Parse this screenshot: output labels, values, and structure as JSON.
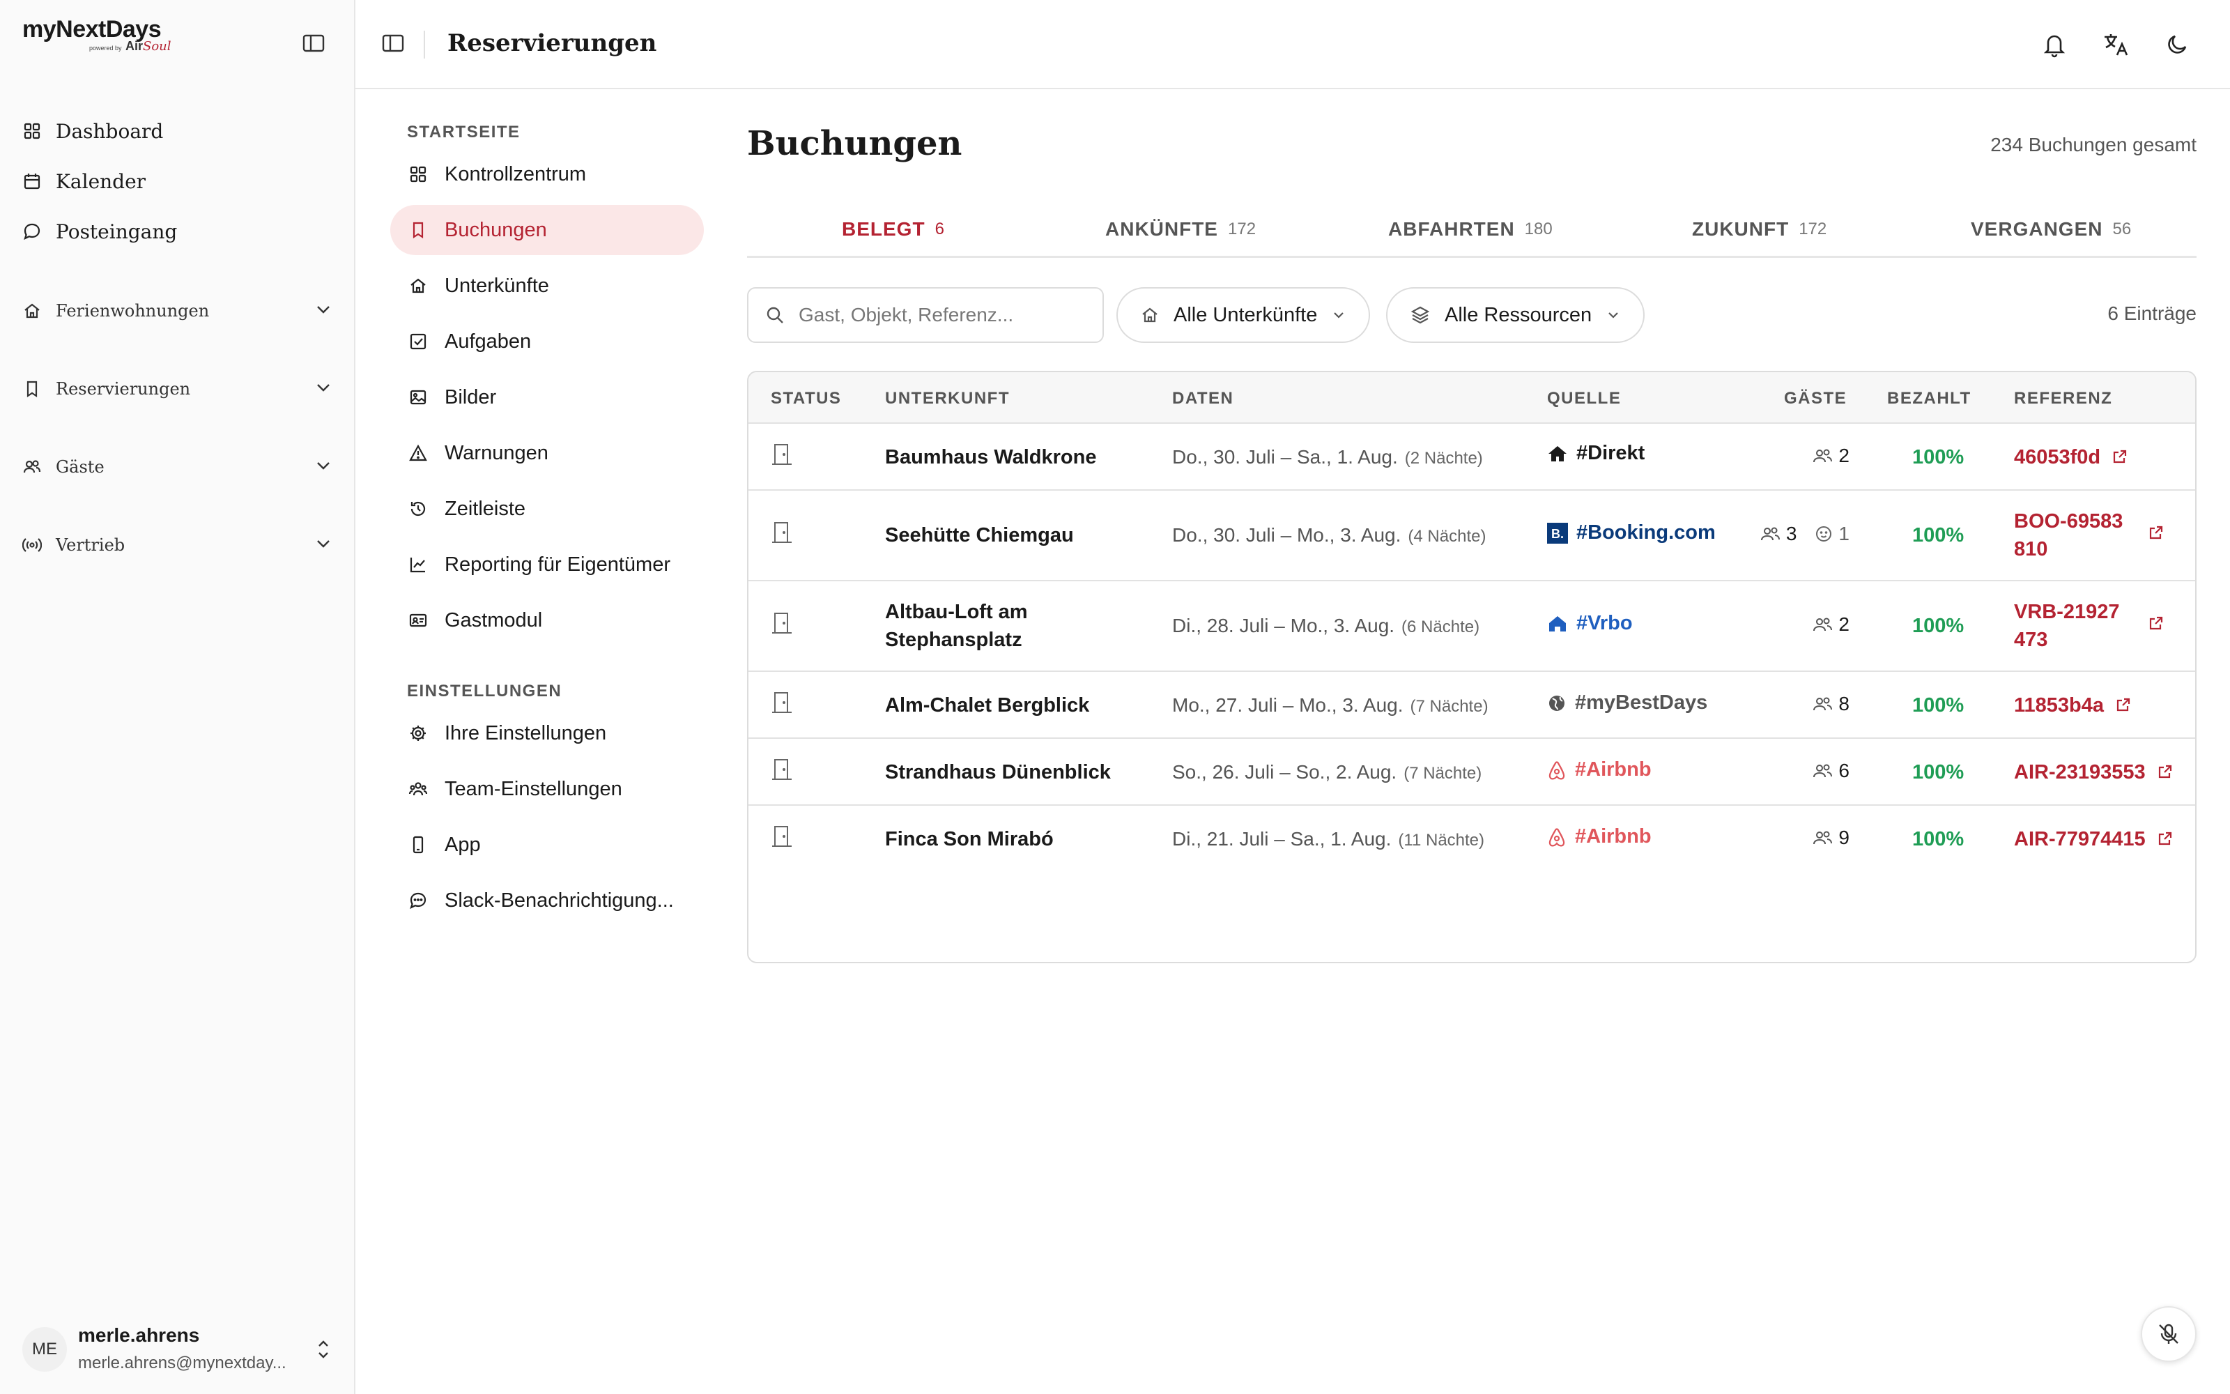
{
  "app": {
    "logo_text": "myNextDays",
    "powered_by": "powered by",
    "brand_prefix": "Air",
    "brand_suffix": "Soul"
  },
  "sidebar": {
    "main_items": [
      {
        "label": "Dashboard",
        "icon": "grid-icon"
      },
      {
        "label": "Kalender",
        "icon": "calendar-icon"
      },
      {
        "label": "Posteingang",
        "icon": "chat-bubble-icon"
      }
    ],
    "groups": [
      {
        "label": "Ferienwohnungen",
        "icon": "house-icon"
      },
      {
        "label": "Reservierungen",
        "icon": "bookmark-icon"
      },
      {
        "label": "Gäste",
        "icon": "users-icon"
      },
      {
        "label": "Vertrieb",
        "icon": "broadcast-icon"
      }
    ],
    "user": {
      "initials": "ME",
      "name": "merle.ahrens",
      "email": "merle.ahrens@mynextday..."
    }
  },
  "header": {
    "title": "Reservierungen"
  },
  "subnav": {
    "sections": [
      {
        "label": "STARTSEITE",
        "items": [
          {
            "label": "Kontrollzentrum",
            "icon": "grid-icon"
          },
          {
            "label": "Buchungen",
            "icon": "bookmark-icon",
            "active": true
          },
          {
            "label": "Unterkünfte",
            "icon": "house-icon"
          },
          {
            "label": "Aufgaben",
            "icon": "checkbox-icon"
          },
          {
            "label": "Bilder",
            "icon": "image-icon"
          },
          {
            "label": "Warnungen",
            "icon": "warning-icon"
          },
          {
            "label": "Zeitleiste",
            "icon": "history-icon"
          },
          {
            "label": "Reporting für Eigentümer",
            "icon": "chart-line-icon"
          },
          {
            "label": "Gastmodul",
            "icon": "id-card-icon"
          }
        ]
      },
      {
        "label": "EINSTELLUNGEN",
        "items": [
          {
            "label": "Ihre Einstellungen",
            "icon": "gear-icon"
          },
          {
            "label": "Team-Einstellungen",
            "icon": "team-icon"
          },
          {
            "label": "App",
            "icon": "phone-icon"
          },
          {
            "label": "Slack-Benachrichtigung...",
            "icon": "message-icon"
          }
        ]
      }
    ]
  },
  "main": {
    "title": "Buchungen",
    "total": "234 Buchungen gesamt",
    "tabs": [
      {
        "label": "BELEGT",
        "count": "6",
        "active": true
      },
      {
        "label": "ANKÜNFTE",
        "count": "172"
      },
      {
        "label": "ABFAHRTEN",
        "count": "180"
      },
      {
        "label": "ZUKUNFT",
        "count": "172"
      },
      {
        "label": "VERGANGEN",
        "count": "56"
      }
    ],
    "search": {
      "placeholder": "Gast, Objekt, Referenz..."
    },
    "filters": {
      "unterkuenfte": "Alle Unterkünfte",
      "ressourcen": "Alle Ressourcen"
    },
    "entries": "6 Einträge",
    "table": {
      "columns": [
        "STATUS",
        "UNTERKUNFT",
        "DATEN",
        "QUELLE",
        "GÄSTE",
        "BEZAHLT",
        "REFERENZ"
      ],
      "rows": [
        {
          "unterkunft": "Baumhaus Waldkrone",
          "daten": "Do., 30. Juli – Sa., 1. Aug.",
          "naechte": "(2 Nächte)",
          "quelle": "#Direkt",
          "quelle_icon": "house-filled-icon",
          "quelle_color": "#1a1a1a",
          "gaeste": "2",
          "bezahlt": "100%",
          "referenz": "46053f0d"
        },
        {
          "unterkunft": "Seehütte Chiemgau",
          "daten": "Do., 30. Juli – Mo., 3. Aug.",
          "naechte": "(4 Nächte)",
          "quelle": "#Booking.com",
          "quelle_icon": "booking-logo-icon",
          "quelle_color": "#0a3a7a",
          "gaeste": "3",
          "kinder": "1",
          "bezahlt": "100%",
          "referenz": "BOO-69583810"
        },
        {
          "unterkunft": "Altbau-Loft am Stephansplatz",
          "daten": "Di., 28. Juli – Mo., 3. Aug.",
          "naechte": "(6 Nächte)",
          "quelle": "#Vrbo",
          "quelle_icon": "vrbo-house-icon",
          "quelle_color": "#1f5fbf",
          "gaeste": "2",
          "bezahlt": "100%",
          "referenz": "VRB-21927473"
        },
        {
          "unterkunft": "Alm-Chalet Bergblick",
          "daten": "Mo., 27. Juli – Mo., 3. Aug.",
          "naechte": "(7 Nächte)",
          "quelle": "#myBestDays",
          "quelle_icon": "globe-icon",
          "quelle_color": "#555555",
          "gaeste": "8",
          "bezahlt": "100%",
          "referenz": "11853b4a"
        },
        {
          "unterkunft": "Strandhaus Dünenblick",
          "daten": "So., 26. Juli – So., 2. Aug.",
          "naechte": "(7 Nächte)",
          "quelle": "#Airbnb",
          "quelle_icon": "airbnb-icon",
          "quelle_color": "#e0565b",
          "gaeste": "6",
          "bezahlt": "100%",
          "referenz": "AIR-23193553"
        },
        {
          "unterkunft": "Finca Son Mirabó",
          "daten": "Di., 21. Juli – Sa., 1. Aug.",
          "naechte": "(11 Nächte)",
          "quelle": "#Airbnb",
          "quelle_icon": "airbnb-icon",
          "quelle_color": "#e0565b",
          "gaeste": "9",
          "bezahlt": "100%",
          "referenz": "AIR-77974415"
        }
      ]
    }
  },
  "colors": {
    "accent": "#b42332",
    "accent_bg": "#fbe7e7",
    "paid": "#1f9d55"
  }
}
